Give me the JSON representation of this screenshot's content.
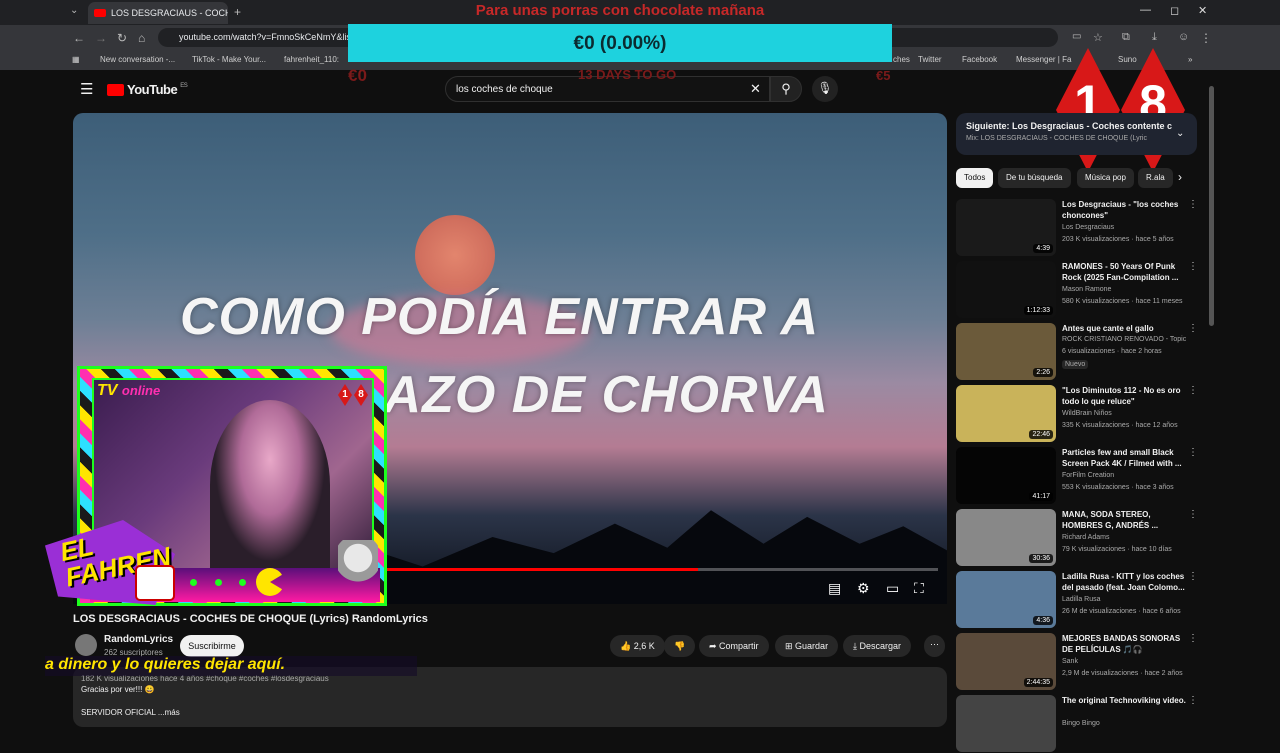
{
  "browser": {
    "tab_title": "LOS DESGRACIAUS - COCHE",
    "url": "youtube.com/watch?v=FmnoSkCeNmY&list=",
    "bookmarks": [
      "New conversation -...",
      "TikTok - Make Your...",
      "fahrenheit_110:",
      "ches",
      "Twitter",
      "Facebook",
      "Messenger | Fa",
      "Suno"
    ]
  },
  "donation": {
    "title": "Para unas porras con chocolate mañana",
    "amount": "€0 (0.00%)",
    "progress": 0,
    "min": "€0",
    "days_left": "13 DAYS TO GO",
    "max": "€5"
  },
  "age_badge": [
    "1",
    "8"
  ],
  "youtube": {
    "logo": "YouTube",
    "region": "ES",
    "search_query": "los coches de choque"
  },
  "video": {
    "lyric_line1": "COMO PODÍA ENTRAR A",
    "lyric_line2": "DAZO DE CHORVA",
    "progress": 0.57,
    "title": "LOS DESGRACIAUS - COCHES DE CHOQUE (Lyrics) RandomLyrics",
    "channel": "RandomLyrics",
    "subscribers": "262 suscriptores",
    "subscribe": "Suscribirme",
    "likes": "2,6 K",
    "share": "Compartir",
    "save": "Guardar",
    "download": "Descargar",
    "desc_stats": "182 K visualizaciones  hace 4 años  #choque #coches #losdesgraciaus",
    "desc_line1": "Gracias por ver!!! 😀",
    "desc_line2": "SERVIDOR OFICIAL ...más"
  },
  "webcam": {
    "tv_label": "TV",
    "online_label": "online",
    "brand_line1": "EL",
    "brand_line2": "FAHREN"
  },
  "ticker": "a dinero y lo quieres dejar aquí.",
  "sidebar": {
    "next_title": "Siguiente: Los Desgraciaus - Coches contente c",
    "next_sub": "Mix: LOS DESGRACIAUS - COCHES DE CHOQUE (Lyric",
    "chips": [
      "Todos",
      "De tu búsqueda",
      "Música pop",
      "R.ala"
    ],
    "recommendations": [
      {
        "title": "Los Desgraciaus - \"los coches choncones\"",
        "channel": "Los Desgraciaus",
        "meta": "203 K visualizaciones · hace 5 años",
        "duration": "4:39",
        "color": "#1a1a1a"
      },
      {
        "title": "RAMONES - 50 Years Of Punk Rock (2025 Fan-Compilation ...",
        "channel": "Mason Ramone",
        "meta": "580 K visualizaciones · hace 11 meses",
        "duration": "1:12:33",
        "color": "#111111"
      },
      {
        "title": "Antes que cante el gallo",
        "channel": "ROCK CRISTIANO RENOVADO - Topic",
        "meta": "6 visualizaciones · hace 2 horas",
        "badge": "Nuevo",
        "duration": "2:26",
        "color": "#6b5a3a"
      },
      {
        "title": "\"Los Diminutos 112 - No es oro todo lo que reluce\"",
        "channel": "WildBrain Niños",
        "meta": "335 K visualizaciones · hace 12 años",
        "duration": "22:46",
        "color": "#c9b35a"
      },
      {
        "title": "Particles few and small Black Screen Pack 4K / Filmed with ...",
        "channel": "ForFilm Creation",
        "meta": "553 K visualizaciones · hace 3 años",
        "duration": "41:17",
        "color": "#050505"
      },
      {
        "title": "MANA, SODA STEREO, HOMBRES G, ANDRÉS ...",
        "channel": "Richard Adams",
        "meta": "79 K visualizaciones · hace 10 días",
        "duration": "30:36",
        "color": "#888888"
      },
      {
        "title": "Ladilla Rusa - KITT y los coches del pasado (feat. Joan Colomo...",
        "channel": "Ladilla Rusa",
        "meta": "26 M de visualizaciones · hace 6 años",
        "duration": "4:36",
        "color": "#5a7a9a"
      },
      {
        "title": "MEJORES BANDAS SONORAS DE PELÍCULAS 🎵🎧",
        "channel": "Sank",
        "meta": "2,9 M de visualizaciones · hace 2 años",
        "duration": "2:44:35",
        "color": "#5a4a3a"
      },
      {
        "title": "The original Technoviking video.",
        "channel": "Bingo Bingo",
        "meta": "",
        "duration": "",
        "color": "#444444"
      }
    ]
  }
}
